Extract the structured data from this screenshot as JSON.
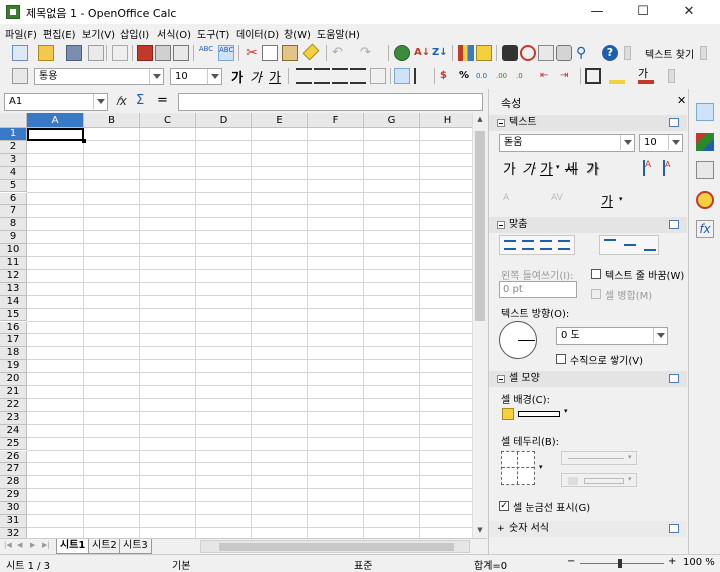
{
  "window": {
    "title": "제목없음 1 - OpenOffice Calc",
    "minimize": "—",
    "maximize": "☐",
    "close": "✕"
  },
  "menu": [
    "파일(F)",
    "편집(E)",
    "보기(V)",
    "삽입(I)",
    "서식(O)",
    "도구(T)",
    "데이터(D)",
    "창(W)",
    "도움말(H)"
  ],
  "toolbar": {
    "find_text": "텍스트 찾기"
  },
  "format": {
    "style": "통용",
    "font_size": "10",
    "bold": "가",
    "italic": "가",
    "underline": "가"
  },
  "formula": {
    "name_box": "A1",
    "fx": "𝑓x",
    "sum": "Σ",
    "equals": "=",
    "value": ""
  },
  "grid": {
    "columns": [
      "A",
      "B",
      "C",
      "D",
      "E",
      "F",
      "G",
      "H"
    ],
    "rows": [
      "1",
      "2",
      "3",
      "4",
      "5",
      "6",
      "7",
      "8",
      "9",
      "10",
      "11",
      "12",
      "13",
      "14",
      "15",
      "16",
      "17",
      "18",
      "19",
      "20",
      "21",
      "22",
      "23",
      "24",
      "25",
      "26",
      "27",
      "28",
      "29",
      "30",
      "31",
      "32"
    ],
    "active_cell": "A1"
  },
  "sheets": [
    "시트1",
    "시트2",
    "시트3"
  ],
  "status": {
    "sheet": "시트 1 / 3",
    "style": "기본",
    "mode": "표준",
    "sum": "합계=0",
    "zoom": "100 %"
  },
  "sidebar": {
    "title": "속성",
    "close": "✕",
    "text": {
      "header": "텍스트",
      "font": "돋움",
      "size": "10",
      "bold": "가",
      "italic": "가",
      "underline": "가",
      "wide": "세",
      "shadow": "가",
      "fontcolor": "가"
    },
    "align": {
      "header": "맞춤",
      "indent_label": "왼쪽 들여쓰기(I):",
      "indent_value": "0 pt",
      "wrap_label": "텍스트 줄 바꿈(W)",
      "merge_label": "셀 병합(M)",
      "dir_label": "텍스트 방향(O):",
      "angle": "0 도",
      "vertical_label": "수직으로 쌓기(V)"
    },
    "appearance": {
      "header": "셀 모양",
      "bg_label": "셀 배경(C):",
      "border_label": "셀 테두리(B):",
      "gridlines_label": "셀 눈금선 표시(G)"
    },
    "number": {
      "header": "숫자 서식"
    }
  }
}
